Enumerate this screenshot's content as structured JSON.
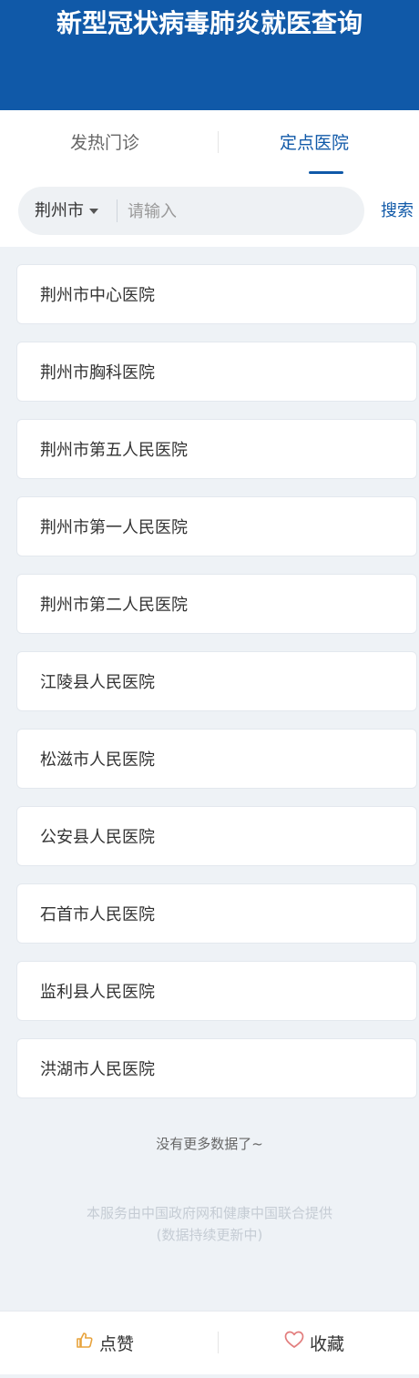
{
  "header": {
    "title": "新型冠状病毒肺炎就医查询"
  },
  "tabs": [
    {
      "label": "发热门诊"
    },
    {
      "label": "定点医院",
      "active": true
    }
  ],
  "search": {
    "city": "荆州市",
    "placeholder": "请输入",
    "button_label": "搜索"
  },
  "hospitals": [
    {
      "name": "荆州市中心医院"
    },
    {
      "name": "荆州市胸科医院"
    },
    {
      "name": "荆州市第五人民医院"
    },
    {
      "name": "荆州市第一人民医院"
    },
    {
      "name": "荆州市第二人民医院"
    },
    {
      "name": "江陵县人民医院"
    },
    {
      "name": "松滋市人民医院"
    },
    {
      "name": "公安县人民医院"
    },
    {
      "name": "石首市人民医院"
    },
    {
      "name": "监利县人民医院"
    },
    {
      "name": "洪湖市人民医院"
    }
  ],
  "list_end_text": "没有更多数据了~",
  "footer": {
    "line1": "本服务由中国政府网和健康中国联合提供",
    "line2": "(数据持续更新中)"
  },
  "bottom_bar": {
    "like_label": "点赞",
    "like_icon": "thumbs-up-icon",
    "favorite_label": "收藏",
    "favorite_icon": "heart-icon"
  },
  "colors": {
    "brand_blue": "#1059a8",
    "like_icon": "#e8a33c",
    "favorite_icon": "#e27d7d"
  }
}
